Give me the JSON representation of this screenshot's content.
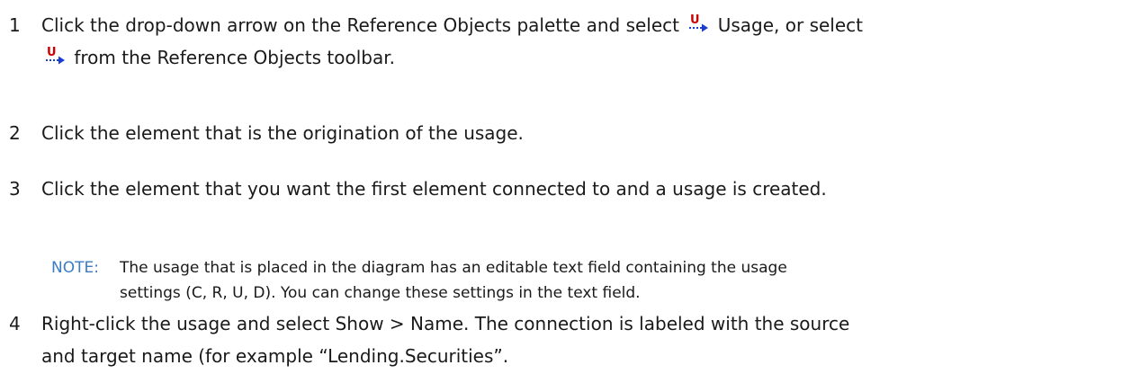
{
  "steps": [
    {
      "number": "1",
      "text_before_icon": "Click the drop-down arrow on the Reference Objects palette and select ",
      "text_after_icon": " Usage, or select",
      "line2_after_icon": " from the Reference Objects toolbar."
    },
    {
      "number": "2",
      "text": "Click the element that is the origination of the usage."
    },
    {
      "number": "3",
      "text": "Click the element that you want the first element connected to and a usage is created."
    },
    {
      "number": "4",
      "text": "Right-click the usage and select Show > Name. The connection is labeled with the source",
      "line2": "and target name (for example “Lending.Securities”."
    }
  ],
  "note": {
    "label": "NOTE:",
    "line1": "The usage that is placed in the diagram has an editable text field containing the usage",
    "line2": "settings (C, R, U, D). You can change these settings in the text field."
  },
  "icons": {
    "usage_icon": "usage-icon",
    "usage_letter": "U",
    "icon_red": "#cc0000",
    "icon_blue": "#1a3ccf"
  },
  "colors": {
    "note_label": "#3b7cc4",
    "text": "#1a1a1a"
  }
}
